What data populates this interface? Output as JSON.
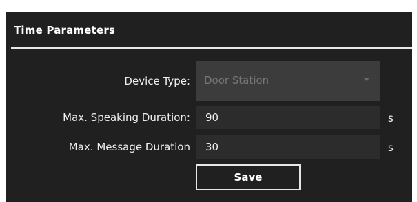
{
  "section": {
    "title": "Time Parameters"
  },
  "form": {
    "device_type": {
      "label": "Device Type:",
      "value": "Door Station",
      "icon": "chevron-down-icon"
    },
    "max_speaking_duration": {
      "label": "Max. Speaking Duration:",
      "value": "90",
      "unit": "s"
    },
    "max_message_duration": {
      "label": "Max. Message Duration",
      "value": "30",
      "unit": "s"
    }
  },
  "actions": {
    "save_label": "Save"
  },
  "colors": {
    "panel_background": "#202020",
    "input_background": "#2c2c2c",
    "disabled_select_background": "#3c3c3c",
    "text": "#eeeeee",
    "disabled_text": "#777777"
  }
}
